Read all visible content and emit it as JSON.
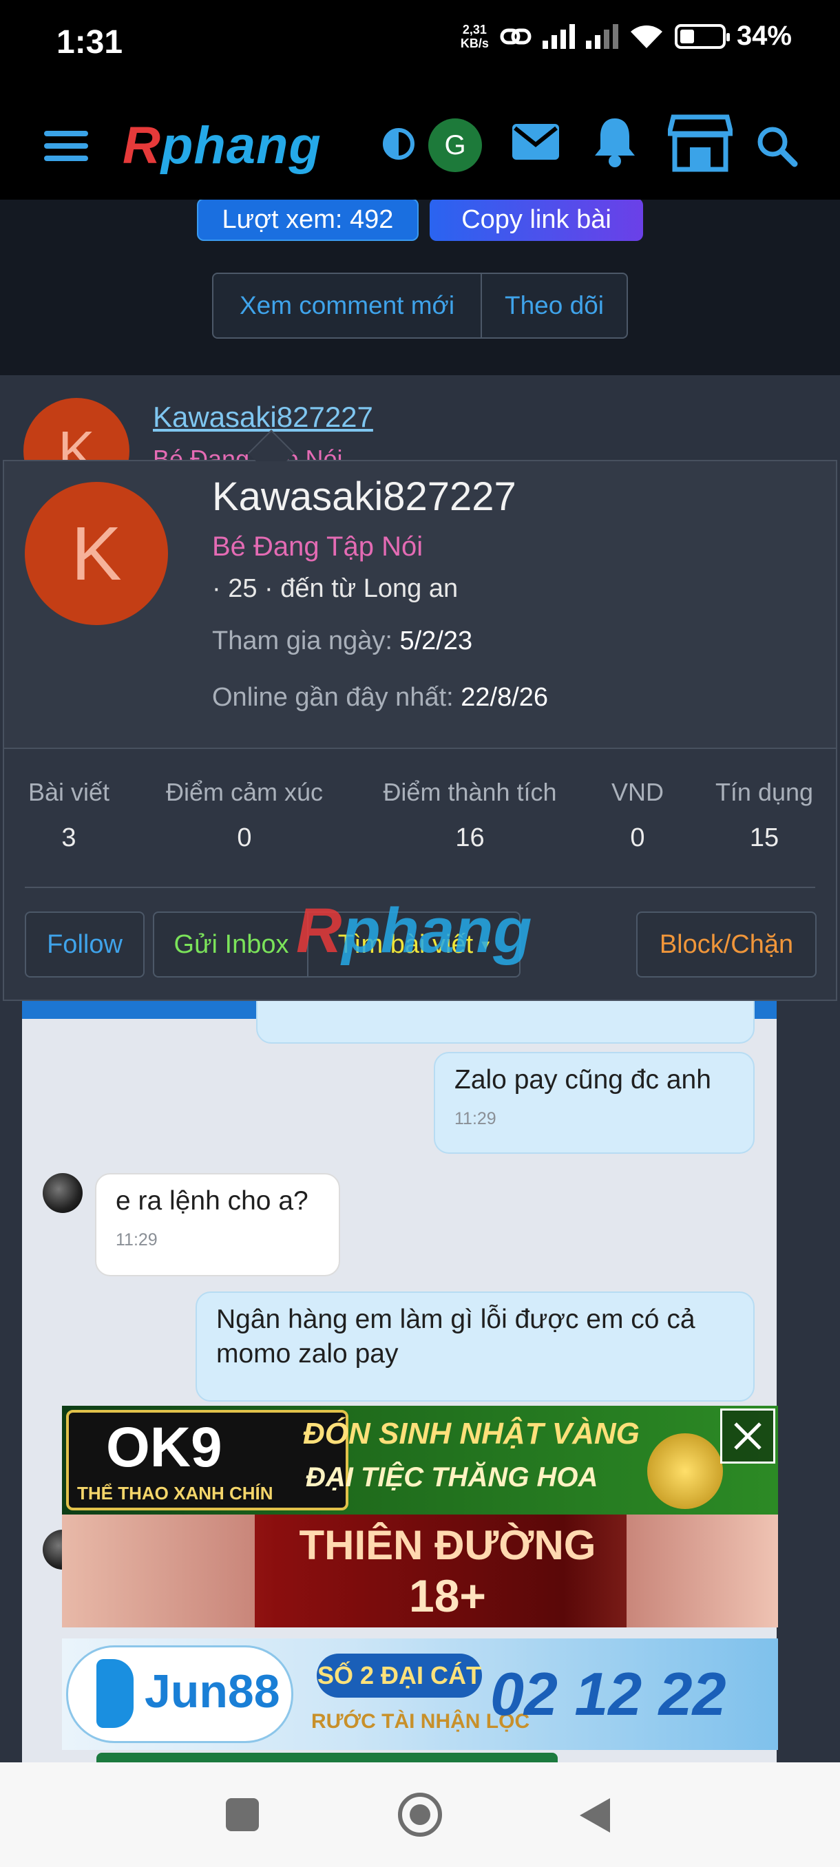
{
  "status_bar": {
    "time": "1:31",
    "net_speed_value": "2,31",
    "net_speed_unit": "KB/s",
    "battery": "34%"
  },
  "header": {
    "logo_first": "R",
    "logo_rest": "phang"
  },
  "thread_actions": {
    "views": "Lượt xem: 492",
    "copy_link": "Copy link bài",
    "view_new_comments": "Xem comment mới",
    "follow_thread": "Theo dõi"
  },
  "post": {
    "avatar_letter": "K",
    "username": "Kawasaki827227",
    "user_title_peek": "Bé Đang Tập Nói"
  },
  "profile_popup": {
    "avatar_letter": "K",
    "username": "Kawasaki827227",
    "user_title": "Bé Đang Tập Nói",
    "meta": "· 25 · đến từ Long an",
    "joined_label": "Tham gia ngày:",
    "joined_value": "5/2/23",
    "online_label": "Online gần đây nhất:",
    "online_value": "22/8/26",
    "stats": [
      {
        "label": "Bài viết",
        "value": "3"
      },
      {
        "label": "Điểm cảm xúc",
        "value": "0"
      },
      {
        "label": "Điểm thành tích",
        "value": "16"
      },
      {
        "label": "VND",
        "value": "0"
      },
      {
        "label": "Tín dụng",
        "value": "15"
      }
    ],
    "buttons": {
      "follow": "Follow",
      "send_inbox": "Gửi Inbox",
      "find_posts": "Tìm bài viết",
      "block": "Block/Chặn"
    },
    "colors": {
      "follow": "#3fa3ea",
      "send_inbox": "#7be35a",
      "find_posts": "#f0e63a",
      "block": "#f0963a"
    }
  },
  "chat": {
    "messages": [
      {
        "side": "out",
        "text": "Zalo pay cũng đc anh",
        "time": "11:29"
      },
      {
        "side": "in",
        "text": "e ra lệnh cho a?",
        "time": "11:29"
      },
      {
        "side": "out",
        "text": "Ngân hàng em làm gì lỗi được em có cả momo zalo pay",
        "time": ""
      }
    ]
  },
  "ads": {
    "ad1_brand": "OK9",
    "ad1_tagline": "THỂ THAO XANH CHÍN",
    "ad1_headline": "ĐÓN SINH NHẬT VÀNG",
    "ad1_subline": "ĐẠI TIỆC THĂNG HOA",
    "ad2_headline": "THIÊN ĐƯỜNG",
    "ad2_sub": "18+",
    "ad3_brand": "Jun88",
    "ad3_headline": "SỐ 2 ĐẠI CÁT",
    "ad3_sub": "RƯỚC TÀI NHẬN LỘC",
    "ad3_number": "02 12 22"
  }
}
